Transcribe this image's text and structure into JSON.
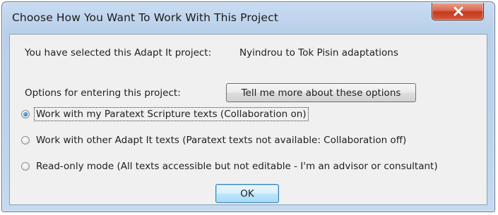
{
  "window": {
    "title": "Choose How You Want To Work With This Project",
    "close_label": "X"
  },
  "project": {
    "label": "You have selected this Adapt It project:",
    "name": "Nyindrou to Tok Pisin adaptations"
  },
  "options": {
    "label": "Options for entering this project:",
    "more_button": "Tell me more about these options"
  },
  "radios": [
    {
      "label": "Work with my Paratext Scripture texts (Collaboration on)",
      "selected": true
    },
    {
      "label": "Work with other Adapt It texts (Paratext texts not available: Collaboration off)",
      "selected": false
    },
    {
      "label": "Read-only mode (All texts accessible but not editable - I'm an advisor or consultant)",
      "selected": false
    }
  ],
  "ok_button": "OK",
  "colors": {
    "titlebar": "#b9d0ea",
    "client_bg": "#f0f0f0",
    "close_button": "#c33a1d",
    "default_button": "#bee6fd"
  }
}
